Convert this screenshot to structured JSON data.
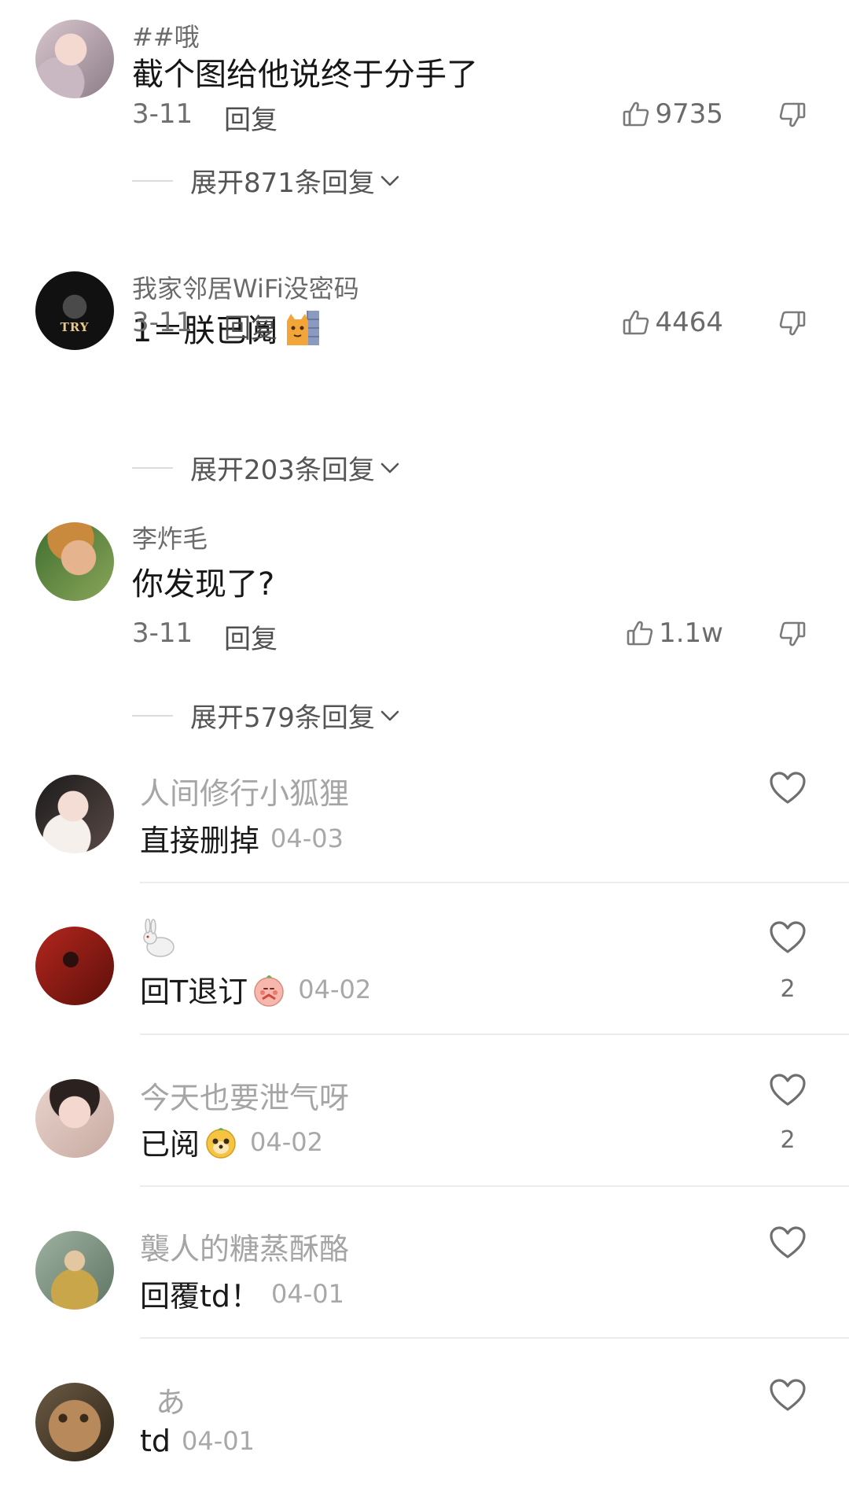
{
  "comments": [
    {
      "username": "##哦",
      "text": "截个图给他说终于分手了",
      "date": "3-11",
      "reply_label": "回复",
      "likes": "9735",
      "expand_label": "展开871条回复"
    },
    {
      "username": "我家邻居WiFi没密码",
      "text": "1＝朕已阅",
      "avatar_text": "TRY",
      "date": "3-11",
      "reply_label": "回复",
      "likes": "4464",
      "expand_label": "展开203条回复"
    },
    {
      "username": "李炸毛",
      "text": "你发现了?",
      "date": "3-11",
      "reply_label": "回复",
      "likes": "1.1w",
      "expand_label": "展开579条回复"
    }
  ],
  "replies": [
    {
      "username": "人间修行小狐狸",
      "text": "直接删掉",
      "date": "04-03",
      "likes": ""
    },
    {
      "username": "🐇",
      "text": "回T退订",
      "date": "04-02",
      "likes": "2"
    },
    {
      "username": "今天也要泄气呀",
      "text": "已阅",
      "date": "04-02",
      "likes": "2"
    },
    {
      "username": "襲人的糖蒸酥酪",
      "text": "回覆td！",
      "date": "04-01",
      "likes": ""
    },
    {
      "username": "あ",
      "text": "td",
      "date": "04-01",
      "likes": ""
    }
  ],
  "icons": {
    "like": "thumb-up-icon",
    "dislike": "thumb-down-icon",
    "heart": "heart-icon",
    "expand": "chevron-down-icon"
  }
}
